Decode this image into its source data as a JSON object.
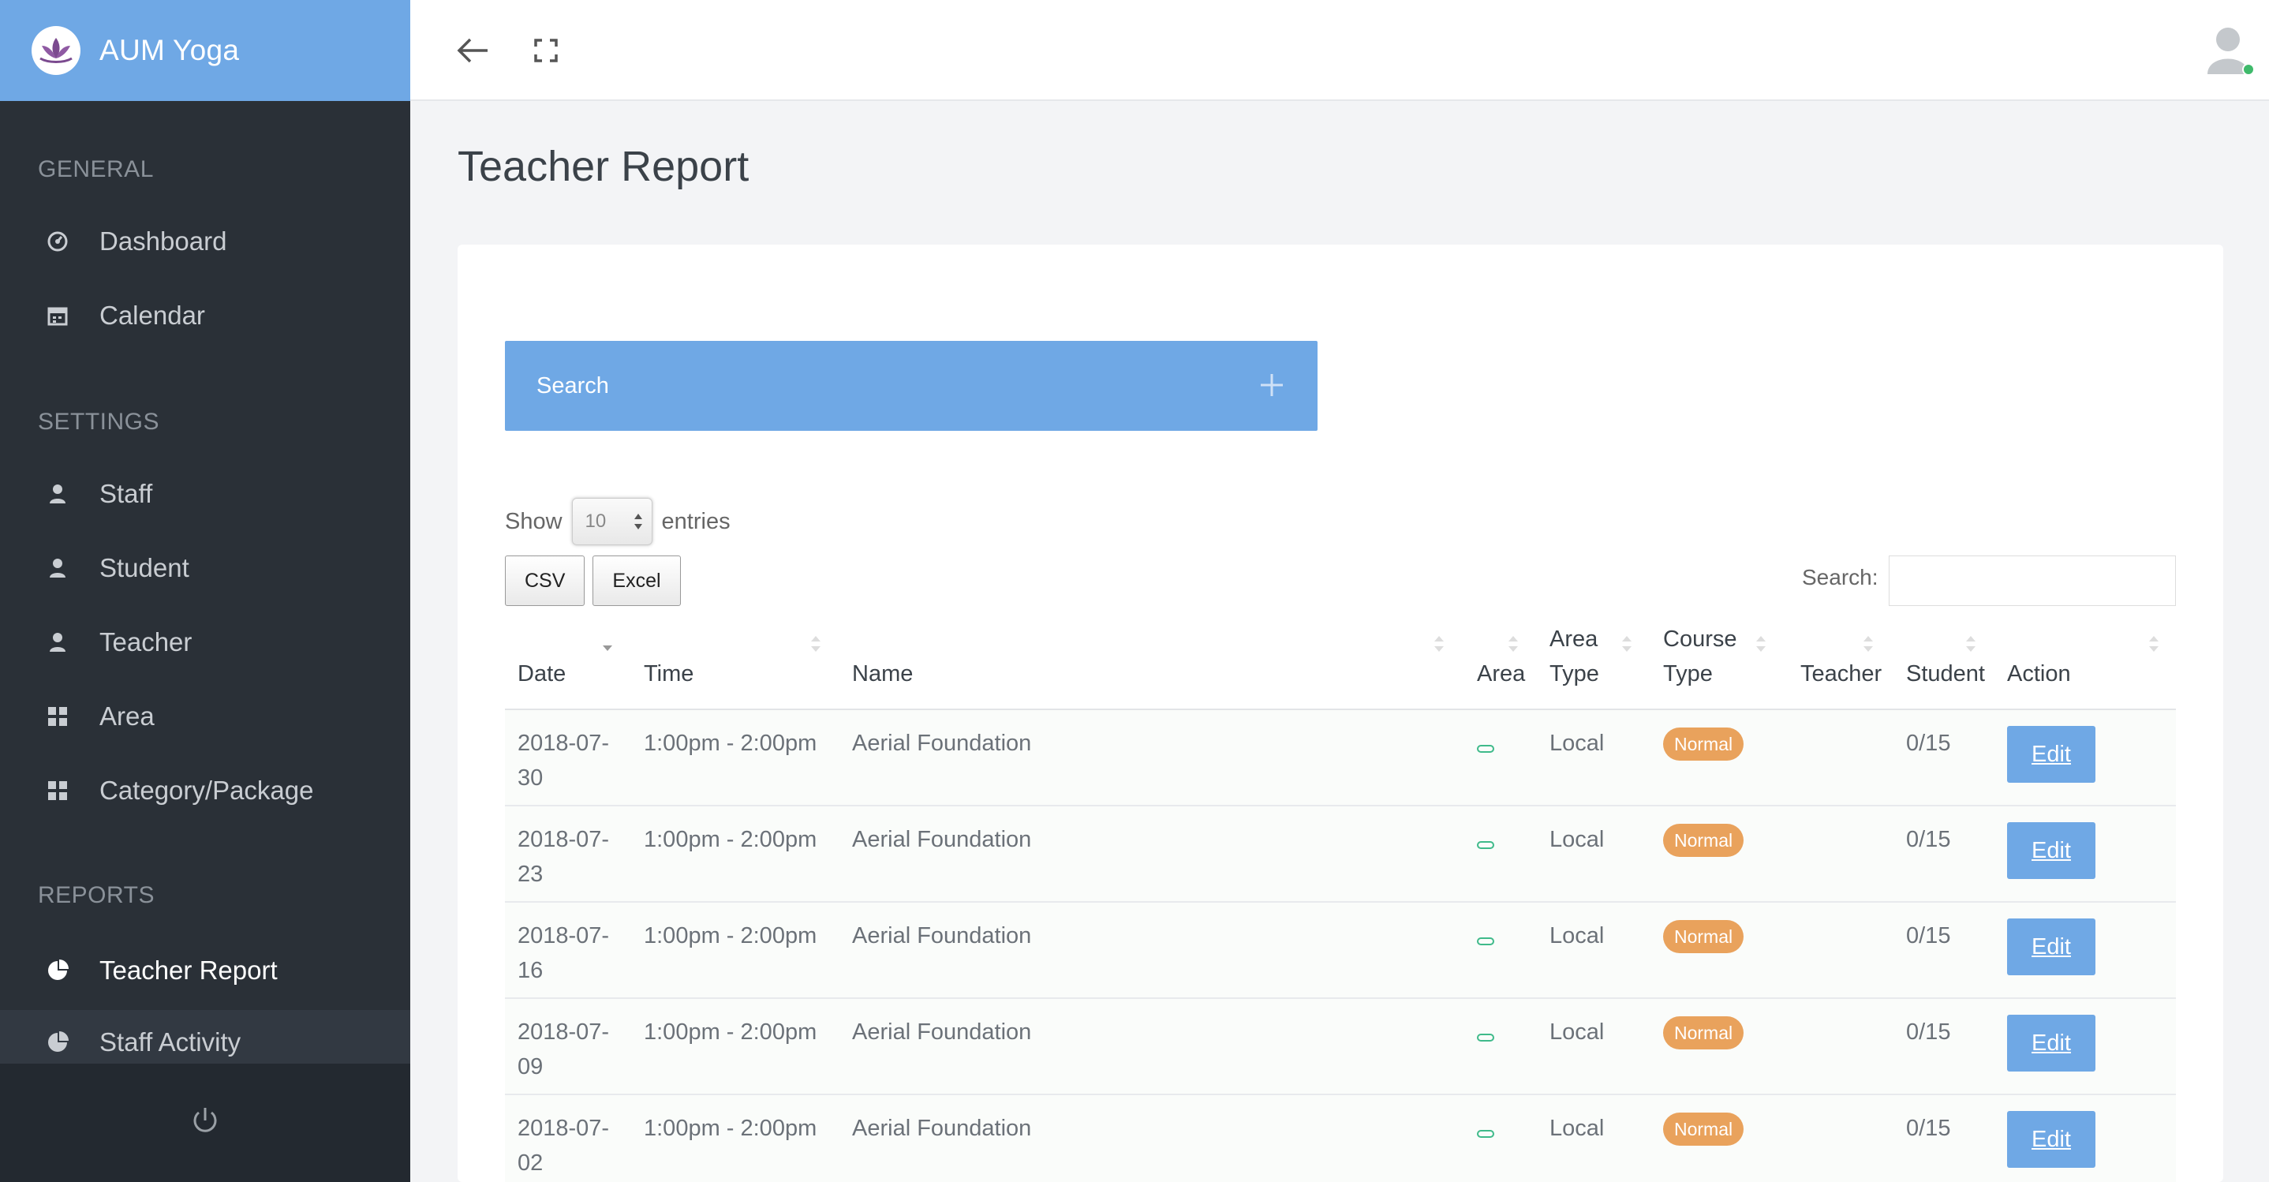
{
  "brand": {
    "title": "AUM Yoga"
  },
  "colors": {
    "accent": "#6fa8e5",
    "sidebar": "#2a3037",
    "badge": "#e9a25c",
    "area_indicator": "#3fba8a"
  },
  "sidebar": {
    "sections": [
      {
        "label": "GENERAL"
      },
      {
        "label": "SETTINGS"
      },
      {
        "label": "REPORTS"
      }
    ],
    "items": [
      {
        "label": "Dashboard",
        "icon": "dashboard-icon"
      },
      {
        "label": "Calendar",
        "icon": "calendar-icon"
      },
      {
        "label": "Staff",
        "icon": "user-icon"
      },
      {
        "label": "Student",
        "icon": "user-icon"
      },
      {
        "label": "Teacher",
        "icon": "user-icon"
      },
      {
        "label": "Area",
        "icon": "grid-icon"
      },
      {
        "label": "Category/Package",
        "icon": "grid-icon"
      },
      {
        "label": "Teacher Report",
        "icon": "pie-chart-icon",
        "active": true
      },
      {
        "label": "Staff Activity",
        "icon": "pie-chart-icon"
      }
    ],
    "footer_icon": "power-icon"
  },
  "topbar": {
    "back_icon": "arrow-left-icon",
    "expand_icon": "fullscreen-icon",
    "avatar_icon": "user-avatar-icon"
  },
  "page": {
    "title": "Teacher Report"
  },
  "search_panel": {
    "label": "Search",
    "icon": "plus-icon"
  },
  "table_controls": {
    "show_label": "Show",
    "entries_value": "10",
    "entries_label": "entries",
    "csv_label": "CSV",
    "excel_label": "Excel",
    "search_label": "Search:",
    "search_value": ""
  },
  "table": {
    "columns": [
      {
        "line1": "",
        "line2": "Date"
      },
      {
        "line1": "",
        "line2": "Time"
      },
      {
        "line1": "",
        "line2": "Name"
      },
      {
        "line1": "",
        "line2": "Area"
      },
      {
        "line1": "Area",
        "line2": "Type"
      },
      {
        "line1": "Course",
        "line2": "Type"
      },
      {
        "line1": "",
        "line2": "Teacher"
      },
      {
        "line1": "",
        "line2": "Student"
      },
      {
        "line1": "",
        "line2": "Action"
      }
    ],
    "rows": [
      {
        "date_line1": "2018-07-",
        "date_line2": "30",
        "time": "1:00pm - 2:00pm",
        "name": "Aerial Foundation",
        "area_type": "Local",
        "course_type": "Normal",
        "teacher": "",
        "student": "0/15",
        "action": "Edit"
      },
      {
        "date_line1": "2018-07-",
        "date_line2": "23",
        "time": "1:00pm - 2:00pm",
        "name": "Aerial Foundation",
        "area_type": "Local",
        "course_type": "Normal",
        "teacher": "",
        "student": "0/15",
        "action": "Edit"
      },
      {
        "date_line1": "2018-07-",
        "date_line2": "16",
        "time": "1:00pm - 2:00pm",
        "name": "Aerial Foundation",
        "area_type": "Local",
        "course_type": "Normal",
        "teacher": "",
        "student": "0/15",
        "action": "Edit"
      },
      {
        "date_line1": "2018-07-",
        "date_line2": "09",
        "time": "1:00pm - 2:00pm",
        "name": "Aerial Foundation",
        "area_type": "Local",
        "course_type": "Normal",
        "teacher": "",
        "student": "0/15",
        "action": "Edit"
      },
      {
        "date_line1": "2018-07-",
        "date_line2": "02",
        "time": "1:00pm - 2:00pm",
        "name": "Aerial Foundation",
        "area_type": "Local",
        "course_type": "Normal",
        "teacher": "",
        "student": "0/15",
        "action": "Edit"
      }
    ]
  }
}
